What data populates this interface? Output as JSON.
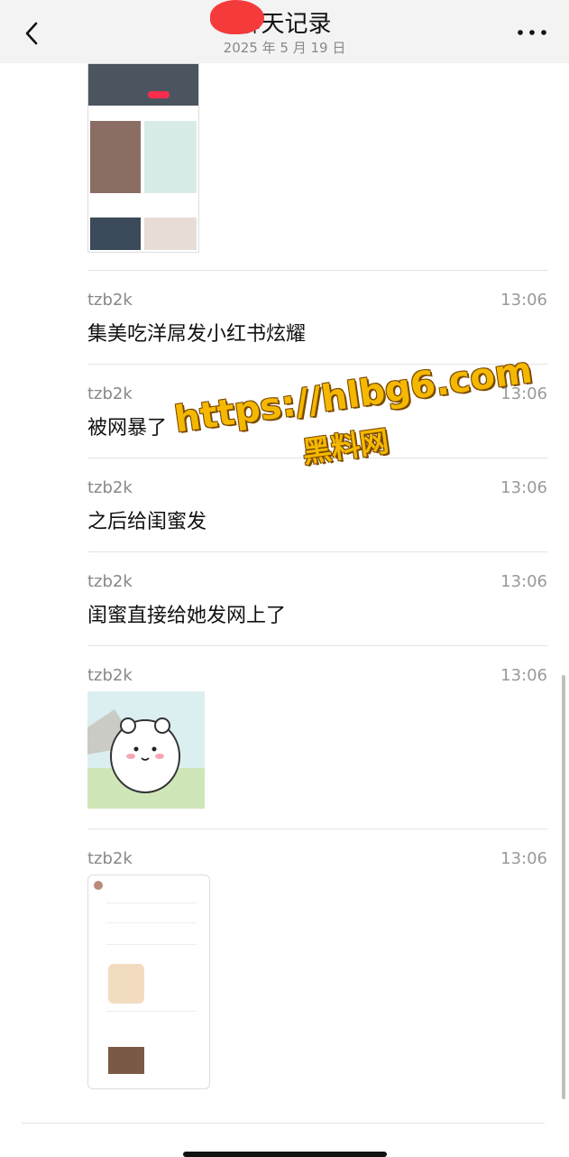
{
  "header": {
    "title": "聊天记录",
    "date": "2025 年 5 月 19 日"
  },
  "messages": [
    {
      "sender": "tzb2k",
      "time": "13:06",
      "text": "集美吃洋屌发小红书炫耀"
    },
    {
      "sender": "tzb2k",
      "time": "13:06",
      "text": "被网暴了"
    },
    {
      "sender": "tzb2k",
      "time": "13:06",
      "text": "之后给闺蜜发"
    },
    {
      "sender": "tzb2k",
      "time": "13:06",
      "text": "闺蜜直接给她发网上了"
    },
    {
      "sender": "tzb2k",
      "time": "13:06",
      "text": ""
    },
    {
      "sender": "tzb2k",
      "time": "13:06",
      "text": ""
    }
  ],
  "watermark": {
    "url": "https://hlbg6.com",
    "name": "黑料网"
  },
  "colors": {
    "header_bg": "#f3f3f3",
    "watermark": "#f5b800",
    "redact": "#f43a3a"
  }
}
